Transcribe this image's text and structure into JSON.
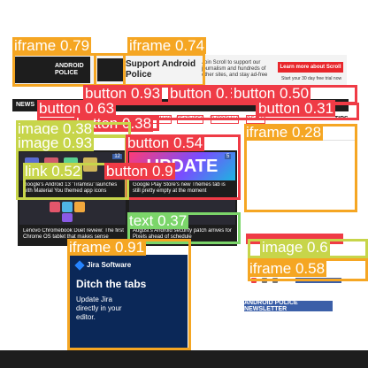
{
  "ad_banner": {
    "brand_logo_text": "ANDROID POLICE",
    "title": "Support Android Police",
    "body": "Join Scroll to support our journalism and hundreds of other sites, and stay ad-free",
    "cta_label": "Learn more about Scroll",
    "footnote": "Start your 30 day free trial now"
  },
  "nav_bar": {
    "label": "NEWS"
  },
  "topic_pills": [
    {
      "label": "GAMEMAKS"
    },
    {
      "label": "FEATURES"
    },
    {
      "label": "TUTORIALS"
    },
    {
      "label": "DEALS"
    }
  ],
  "tips_label": "TIPS",
  "featured": [
    {
      "caption": "Google's Android 13 'Tiramisu' launches with Material You themed app icons",
      "count": "12"
    },
    {
      "image_text": "UPDATE",
      "caption": "Google Play Store's new Themes tab is still pretty empty at the moment",
      "count": "5"
    },
    {
      "caption": "Lenovo Chromebook Duet review: The first Chrome OS tablet that makes sense"
    },
    {
      "caption": "August's Android security patch arrives for Pixels ahead of schedule"
    }
  ],
  "newsletter_banner": "ANDROID POLICE NEWSLETTER",
  "jira_ad": {
    "brand": "Jira Software",
    "title": "Ditch the tabs",
    "body": "Update Jira directly in your editor."
  },
  "detections": [
    {
      "label": "iframe",
      "score": "0.79",
      "color": "orange"
    },
    {
      "label": "iframe",
      "score": "0.74",
      "color": "orange"
    },
    {
      "label": "button",
      "score": "0.93",
      "color": "red"
    },
    {
      "label": "button",
      "score": "0.86",
      "color": "red"
    },
    {
      "label": "button",
      "score": "0.50",
      "color": "red"
    },
    {
      "label": "button",
      "score": "0.63",
      "color": "red"
    },
    {
      "label": "button",
      "score": "0.38",
      "color": "red"
    },
    {
      "label": "button",
      "score": "0.31",
      "color": "red"
    },
    {
      "label": "image",
      "score": "0.38",
      "color": "yellow"
    },
    {
      "label": "image",
      "score": "0.93",
      "color": "yellow"
    },
    {
      "label": "button",
      "score": "0.54",
      "color": "red"
    },
    {
      "label": "iframe",
      "score": "0.28",
      "color": "orange"
    },
    {
      "label": "link",
      "score": "0.52",
      "color": "yellow"
    },
    {
      "label": "text",
      "score": "0.37",
      "color": "green"
    },
    {
      "label": "iframe",
      "score": "0.91",
      "color": "orange"
    },
    {
      "label": "image",
      "score": "0.6",
      "color": "yellow"
    },
    {
      "label": "iframe",
      "score": "0.58",
      "color": "orange"
    },
    {
      "label": "button",
      "score": "0.9",
      "color": "red"
    }
  ]
}
